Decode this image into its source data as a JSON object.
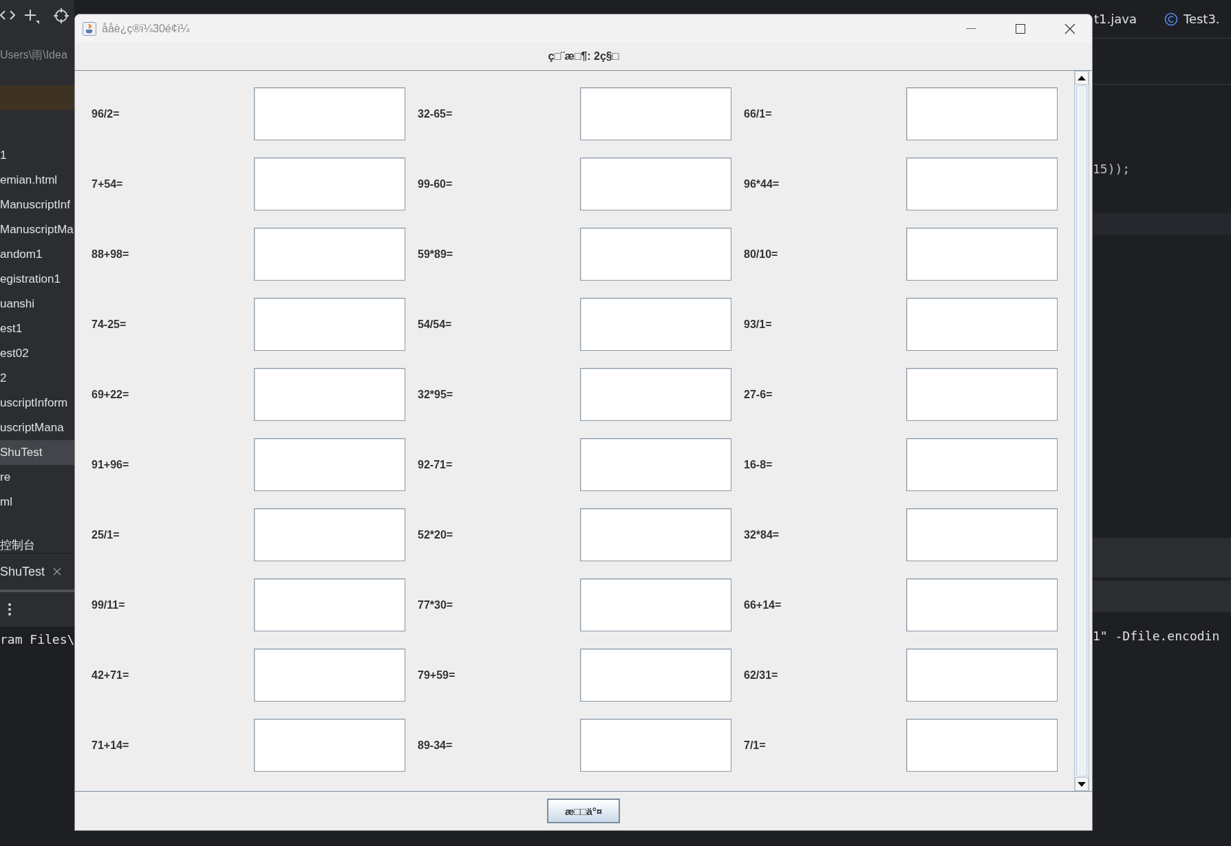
{
  "ide": {
    "path": "Users\\雨\\Idea",
    "editor_tabs": [
      {
        "label": "t1.java",
        "kind": "plain"
      },
      {
        "label": "Test3.",
        "kind": "class"
      }
    ],
    "project_items": [
      {
        "label": "1",
        "selected": false
      },
      {
        "label": "emian.html",
        "selected": false
      },
      {
        "label": "ManuscriptInf",
        "selected": false
      },
      {
        "label": "ManuscriptMa",
        "selected": false
      },
      {
        "label": "andom1",
        "selected": false
      },
      {
        "label": "egistration1",
        "selected": false
      },
      {
        "label": "uanshi",
        "selected": false
      },
      {
        "label": "est1",
        "selected": false
      },
      {
        "label": "est02",
        "selected": false
      },
      {
        "label": "2",
        "selected": false
      },
      {
        "label": "uscriptInform",
        "selected": false
      },
      {
        "label": "uscriptMana",
        "selected": false
      },
      {
        "label": "ShuTest",
        "selected": true
      },
      {
        "label": "re",
        "selected": false
      },
      {
        "label": "ml",
        "selected": false
      }
    ],
    "console_title": "控制台",
    "run_tab": "ShuTest",
    "code_line": "15));",
    "console_left": "ram Files\\",
    "console_right": "1\" -Dfile.encodin"
  },
  "window": {
    "title": "ååè¿ç®ï¼30é¢ï¼",
    "header": "ç□¨æ□¶: 2ç§□",
    "questions": [
      "96/2=",
      "32-65=",
      "66/1=",
      "7+54=",
      "99-60=",
      "96*44=",
      "88+98=",
      "59*89=",
      "80/10=",
      "74-25=",
      "54/54=",
      "93/1=",
      "69+22=",
      "32*95=",
      "27-6=",
      "91+96=",
      "92-71=",
      "16-8=",
      "25/1=",
      "52*20=",
      "32*84=",
      "99/11=",
      "77*30=",
      "66+14=",
      "42+71=",
      "79+59=",
      "62/31=",
      "71+14=",
      "89-34=",
      "7/1="
    ],
    "submit_button": "æ□□ä°¤"
  }
}
